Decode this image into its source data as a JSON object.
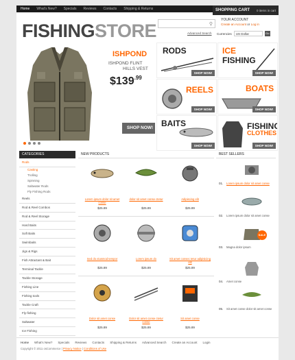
{
  "topnav": {
    "links": [
      "Home",
      "What's New?",
      "Specials",
      "Reviews",
      "Contacts",
      "Shipping & Returns"
    ]
  },
  "cart": {
    "title": "SHOPPING CART",
    "count": "0 items in cart"
  },
  "logo": {
    "part1": "FISHING",
    "part2": "STORE"
  },
  "search": {
    "placeholder": "",
    "advanced": "Advanced Search"
  },
  "account": {
    "title": "YOUR ACCOUNT",
    "create": "Create an Account",
    "sep": "or",
    "login": "Log in"
  },
  "currency": {
    "label": "Currencies",
    "value": "US Dollar",
    "go": "Go"
  },
  "hero": {
    "title": "ISHPOND",
    "subtitle1": "ISHPOND FLINT",
    "subtitle2": "HILLS VEST",
    "price_main": "$139",
    "price_cents": ".99",
    "button": "SHOP NOW!",
    "slide_count": 4,
    "active_slide": 1
  },
  "categories_tiles": [
    {
      "name": "RODS",
      "button": "SHOP NOW!"
    },
    {
      "name": "ICE",
      "name2": "FISHING",
      "button": "SHOP NOW!"
    },
    {
      "name": "REELS",
      "button": "SHOP NOW!"
    },
    {
      "name": "BOATS",
      "button": "SHOP NOW!"
    },
    {
      "name": "BAITS",
      "button": "SHOP NOW!"
    },
    {
      "name": "FISHING",
      "name2": "CLOTHES",
      "button": "SHOP NOW!"
    }
  ],
  "sidebar": {
    "title": "CATEGORIES",
    "items": [
      {
        "label": "Rods",
        "active": true
      },
      {
        "label": "Casting",
        "sub": true,
        "active": true
      },
      {
        "label": "Trolling",
        "sub": true
      },
      {
        "label": "Spinning",
        "sub": true
      },
      {
        "label": "Saltwater Rods",
        "sub": true
      },
      {
        "label": "Fly Fishing Rods",
        "sub": true
      },
      {
        "label": "Reels"
      },
      {
        "label": "Rod & Reel Combos"
      },
      {
        "label": "Rod & Reel Storage"
      },
      {
        "label": "Hard Baits"
      },
      {
        "label": "Soft Baits"
      },
      {
        "label": "Swimbaits"
      },
      {
        "label": "Jigs & Rigs"
      },
      {
        "label": "Fish Attractant & Bait"
      },
      {
        "label": "Terminal Tackle"
      },
      {
        "label": "Tackle Storage"
      },
      {
        "label": "Fishing Line"
      },
      {
        "label": "Fishing tools"
      },
      {
        "label": "Tackle Craft"
      },
      {
        "label": "Fly-fishing"
      },
      {
        "label": "Saltwater"
      },
      {
        "label": "Ice Fishing"
      },
      {
        "label": "Beginner Fishing"
      }
    ]
  },
  "products": {
    "title": "NEW PRODUCTS",
    "items": [
      {
        "name": "Lorem ipsum dolor sit amet conse",
        "price": "$25.89"
      },
      {
        "name": "dolor sit amet conse ctetur",
        "price": "$25.89"
      },
      {
        "name": "Adipiscing elit",
        "price": "$25.89"
      },
      {
        "name": "Sed do eiusmod tempor",
        "price": "$25.89"
      },
      {
        "name": "Lorem ipsum do",
        "price": "$25.89"
      },
      {
        "name": "Sit amet consec tetur adipisicing elit",
        "price": "$25.89"
      },
      {
        "name": "Dolor sit amet conse",
        "price": "$25.89"
      },
      {
        "name": "Dolor sit amet conse ctetur conse",
        "price": "$25.89"
      },
      {
        "name": "Sit amet conse",
        "price": "$25.89"
      }
    ]
  },
  "bestsellers": {
    "title": "BEST SELLERS",
    "items": [
      {
        "num": "01.",
        "text": "Lorem ipsum dolor sit amet conse",
        "link": true
      },
      {
        "num": "02.",
        "text": "Lorem ipsum dolor sit amet conse"
      },
      {
        "num": "03.",
        "text": "Magna dolor ipsum"
      },
      {
        "num": "04.",
        "text": "Amet conse"
      },
      {
        "num": "05.",
        "text": "Sit amet conse dolor sit amet conse"
      }
    ],
    "sale_label": "SALE"
  },
  "footer": {
    "links": [
      "Home",
      "What's New?",
      "Specials",
      "Reviews",
      "Contacts",
      "Shipping & Returns",
      "Advanced Search",
      "Create an Account",
      "Login"
    ],
    "copyright": "Copyright © 2011 osCommerce",
    "privacy": "Privacy Notice",
    "conditions": "Conditions of Use"
  },
  "colors": {
    "accent": "#ff6600",
    "dark": "#1b1b1b",
    "button": "#666666"
  }
}
